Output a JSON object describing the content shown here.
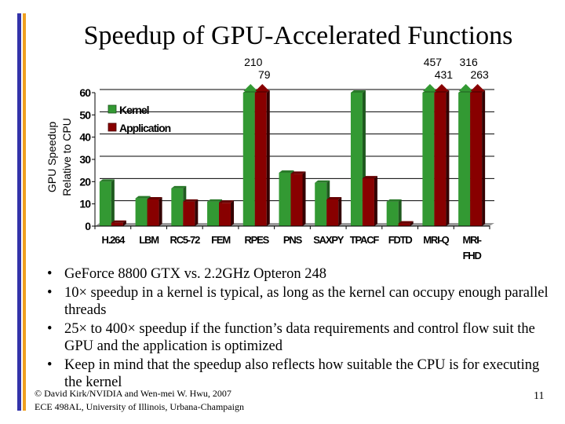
{
  "slide": {
    "title": "Speedup of GPU-Accelerated Functions",
    "bullets": [
      "GeForce 8800 GTX vs. 2.2GHz Opteron 248",
      "10× speedup in a kernel is typical, as long as the kernel can occupy enough parallel threads",
      "25× to 400× speedup if the function’s data requirements and control flow suit the GPU and the application is optimized",
      "Keep in mind that the speedup also reflects how suitable the CPU is for executing the kernel"
    ],
    "bullet_glyph": "•",
    "footer_line1": "© David Kirk/NVIDIA and Wen-mei W. Hwu, 2007",
    "footer_line2": "ECE 498AL, University of Illinois, Urbana-Champaign",
    "page_number": "11",
    "colors": {
      "accent_blue": "#3333aa",
      "accent_orange": "#f0a020"
    }
  },
  "chart_data": {
    "type": "bar",
    "title": "",
    "xlabel": "",
    "ylabel": "GPU Speedup Relative to CPU",
    "ylabel_lines": [
      "GPU Speedup",
      "Relative to CPU"
    ],
    "ylim": [
      0,
      60
    ],
    "yticks": [
      0,
      10,
      20,
      30,
      40,
      50,
      60
    ],
    "grid": true,
    "legend_position": "top-left",
    "categories": [
      "H.264",
      "LBM",
      "RC5-72",
      "FEM",
      "RPES",
      "PNS",
      "SAXPY",
      "TPACF",
      "FDTD",
      "MRI-Q",
      "MRI-FHD"
    ],
    "category_labels": [
      [
        "H.264"
      ],
      [
        "LBM"
      ],
      [
        "RC5-72"
      ],
      [
        "FEM"
      ],
      [
        "RPES"
      ],
      [
        "PNS"
      ],
      [
        "SAXPY"
      ],
      [
        "TPACF"
      ],
      [
        "FDTD"
      ],
      [
        "MRI-Q"
      ],
      [
        "MRI-",
        "FHD"
      ]
    ],
    "series": [
      {
        "name": "Kernel",
        "color": "#339933",
        "values": [
          20,
          12.5,
          17,
          11,
          210,
          24,
          19.5,
          60,
          11,
          457,
          316
        ]
      },
      {
        "name": "Application",
        "color": "#880000",
        "values": [
          1.5,
          12,
          11,
          10.5,
          79,
          23.5,
          12,
          21.5,
          1.2,
          431,
          263
        ]
      }
    ],
    "overflow_annotations": [
      {
        "category": "RPES",
        "kernel": "210",
        "application": "79"
      },
      {
        "category": "MRI-Q",
        "kernel": "457",
        "application": "431"
      },
      {
        "category": "MRI-FHD",
        "kernel": "316",
        "application": "263"
      }
    ]
  }
}
